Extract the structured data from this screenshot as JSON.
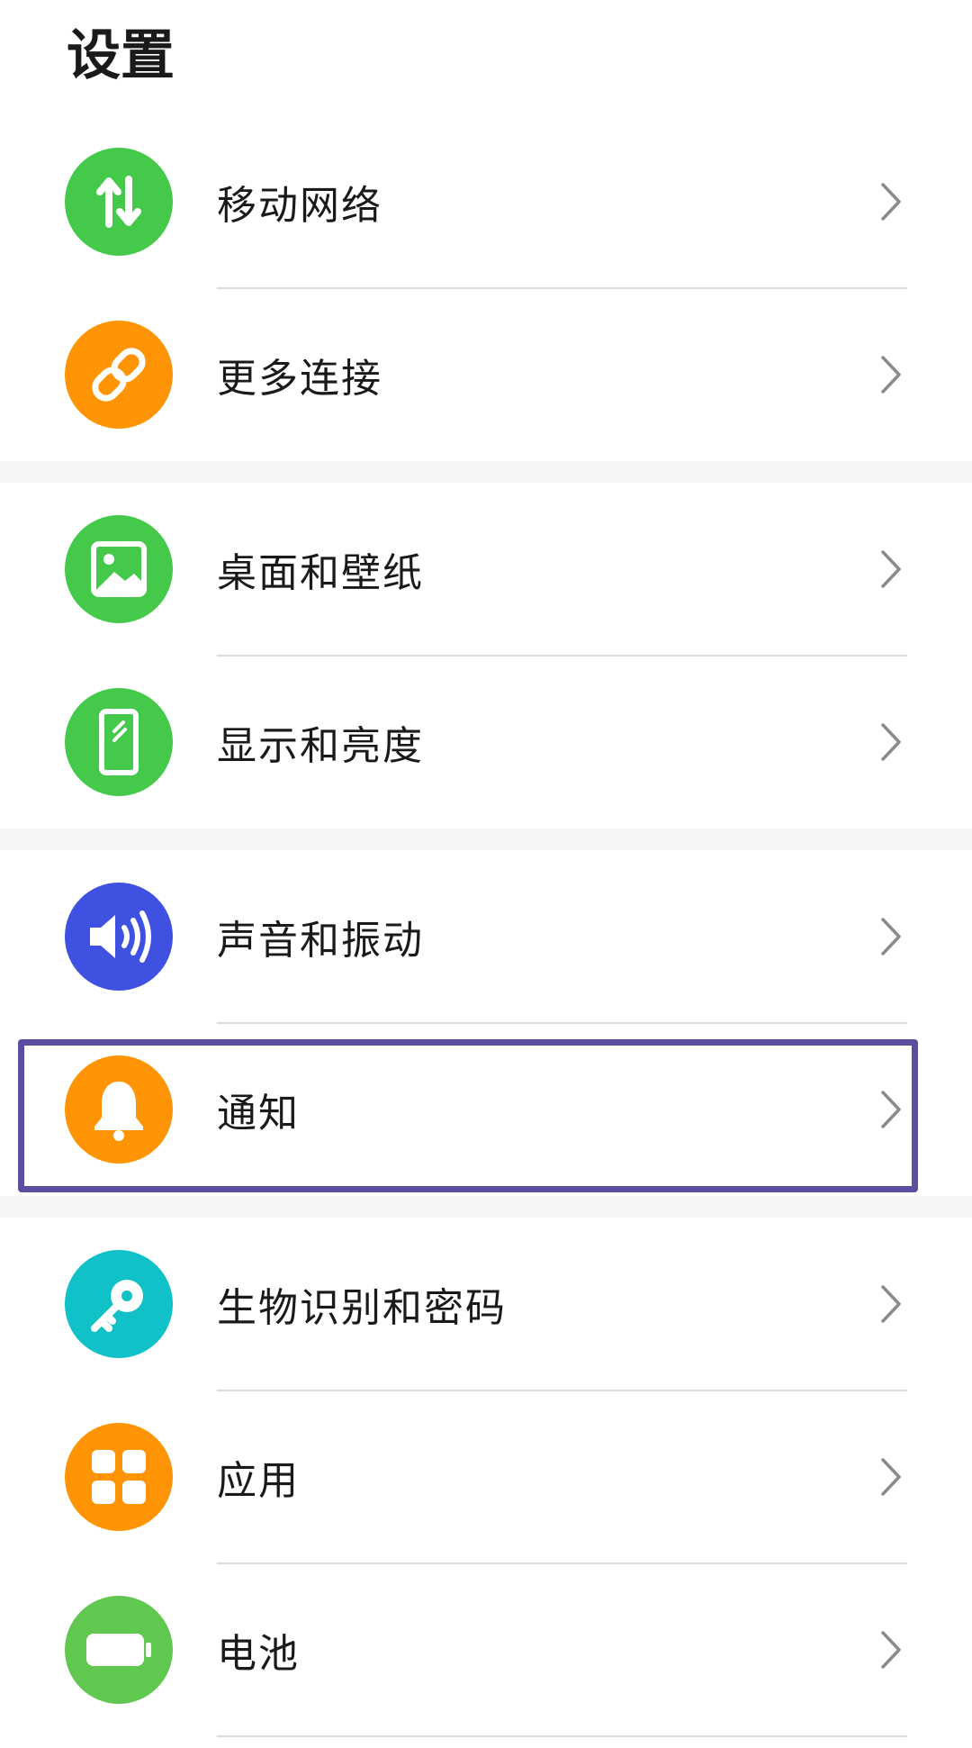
{
  "page": {
    "title": "设置"
  },
  "colors": {
    "green": "#44c94a",
    "orange": "#ff9505",
    "blue": "#3f51e0",
    "teal": "#10c2c8",
    "battery_green": "#61c84f",
    "highlight": "#5b4ea0"
  },
  "settings": [
    {
      "label": "移动网络",
      "icon": "arrows-up-down-icon"
    },
    {
      "label": "更多连接",
      "icon": "link-icon"
    },
    {
      "label": "桌面和壁纸",
      "icon": "image-icon"
    },
    {
      "label": "显示和亮度",
      "icon": "phone-brightness-icon"
    },
    {
      "label": "声音和振动",
      "icon": "speaker-icon"
    },
    {
      "label": "通知",
      "icon": "bell-icon"
    },
    {
      "label": "生物识别和密码",
      "icon": "key-icon"
    },
    {
      "label": "应用",
      "icon": "apps-grid-icon"
    },
    {
      "label": "电池",
      "icon": "battery-icon"
    }
  ]
}
